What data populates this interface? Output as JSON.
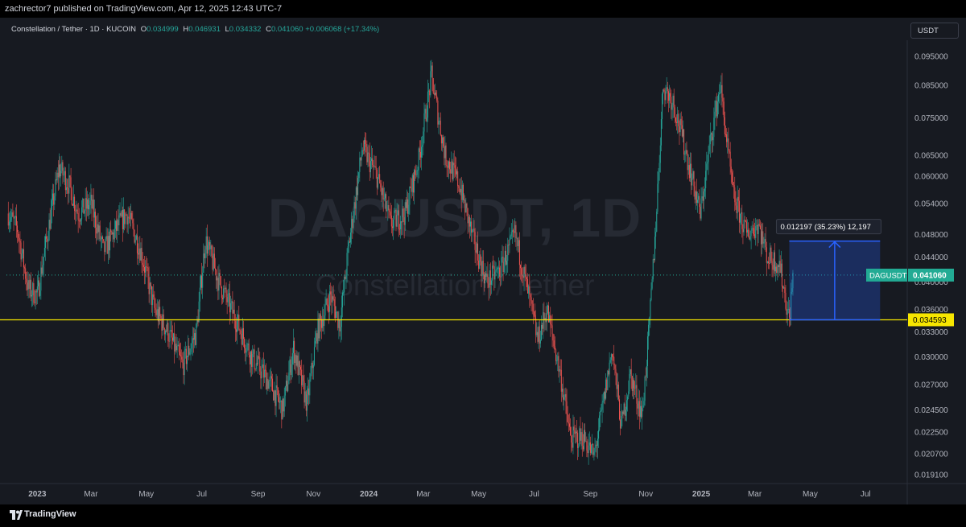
{
  "header": {
    "publisher_line": "zachrector7 published on TradingView.com, Apr 12, 2025 12:43 UTC-7"
  },
  "legend": {
    "symbol": "Constellation / Tether · 1D · KUCOIN",
    "o_label": "O",
    "o_value": "0.034999",
    "h_label": "H",
    "h_value": "0.046931",
    "l_label": "L",
    "l_value": "0.034332",
    "c_label": "C",
    "c_value": "0.041060",
    "change": "+0.006068 (+17.34%)"
  },
  "currency_button": "USDT",
  "watermark": {
    "main": "DAGUSDT, 1D",
    "sub": "Constellation / Tether"
  },
  "footer": {
    "brand": "TradingView"
  },
  "colors": {
    "up": "#26a69a",
    "down": "#ef5350",
    "background": "#171a21",
    "horizontal_line": "#f7e600",
    "measure": "#2962ff",
    "price_label": "#22ab94"
  },
  "chart_data": {
    "type": "candlestick",
    "scale": "log",
    "y_ticks": [
      0.0191,
      0.0207,
      0.0225,
      0.0245,
      0.027,
      0.03,
      0.033,
      0.036,
      0.04,
      0.044,
      0.048,
      0.054,
      0.06,
      0.065,
      0.075,
      0.085,
      0.095
    ],
    "y_tick_labels": [
      "0.019100",
      "0.020700",
      "0.022500",
      "0.024500",
      "0.027000",
      "0.030000",
      "0.033000",
      "0.036000",
      "0.040000",
      "0.044000",
      "0.048000",
      "0.054000",
      "0.060000",
      "0.065000",
      "0.075000",
      "0.085000",
      "0.095000"
    ],
    "x_labels": [
      "2023",
      "Mar",
      "May",
      "Jul",
      "Sep",
      "Nov",
      "2024",
      "Mar",
      "May",
      "Jul",
      "Sep",
      "Nov",
      "2025",
      "Mar",
      "May",
      "Jul"
    ],
    "x_label_dates": [
      "2023-01-01",
      "2023-03-01",
      "2023-05-01",
      "2023-07-01",
      "2023-09-01",
      "2023-11-01",
      "2024-01-01",
      "2024-03-01",
      "2024-05-01",
      "2024-07-01",
      "2024-09-01",
      "2024-11-01",
      "2025-01-01",
      "2025-03-01",
      "2025-05-01",
      "2025-07-01"
    ],
    "x_range": [
      "2022-11-28",
      "2025-08-15"
    ],
    "price_path": [
      [
        "2022-11-30",
        0.052
      ],
      [
        "2022-12-10",
        0.049
      ],
      [
        "2022-12-22",
        0.039
      ],
      [
        "2023-01-01",
        0.038
      ],
      [
        "2023-01-10",
        0.046
      ],
      [
        "2023-01-25",
        0.062
      ],
      [
        "2023-02-05",
        0.058
      ],
      [
        "2023-02-15",
        0.052
      ],
      [
        "2023-03-01",
        0.054
      ],
      [
        "2023-03-15",
        0.045
      ],
      [
        "2023-04-01",
        0.05
      ],
      [
        "2023-04-10",
        0.052
      ],
      [
        "2023-04-25",
        0.045
      ],
      [
        "2023-05-10",
        0.036
      ],
      [
        "2023-05-25",
        0.033
      ],
      [
        "2023-06-10",
        0.029
      ],
      [
        "2023-06-25",
        0.033
      ],
      [
        "2023-07-05",
        0.047
      ],
      [
        "2023-07-20",
        0.04
      ],
      [
        "2023-08-10",
        0.034
      ],
      [
        "2023-08-25",
        0.03
      ],
      [
        "2023-09-15",
        0.027
      ],
      [
        "2023-09-28",
        0.0245
      ],
      [
        "2023-10-10",
        0.031
      ],
      [
        "2023-10-25",
        0.025
      ],
      [
        "2023-11-05",
        0.033
      ],
      [
        "2023-11-20",
        0.038
      ],
      [
        "2023-11-30",
        0.034
      ],
      [
        "2023-12-10",
        0.046
      ],
      [
        "2023-12-25",
        0.067
      ],
      [
        "2024-01-10",
        0.06
      ],
      [
        "2024-01-25",
        0.05
      ],
      [
        "2024-02-10",
        0.052
      ],
      [
        "2024-02-25",
        0.064
      ],
      [
        "2024-03-10",
        0.088
      ],
      [
        "2024-03-25",
        0.065
      ],
      [
        "2024-04-10",
        0.058
      ],
      [
        "2024-04-25",
        0.047
      ],
      [
        "2024-05-10",
        0.04
      ],
      [
        "2024-05-25",
        0.042
      ],
      [
        "2024-06-10",
        0.048
      ],
      [
        "2024-06-25",
        0.038
      ],
      [
        "2024-07-05",
        0.032
      ],
      [
        "2024-07-15",
        0.036
      ],
      [
        "2024-07-30",
        0.028
      ],
      [
        "2024-08-10",
        0.022
      ],
      [
        "2024-08-25",
        0.022
      ],
      [
        "2024-09-05",
        0.0205
      ],
      [
        "2024-09-15",
        0.025
      ],
      [
        "2024-09-25",
        0.031
      ],
      [
        "2024-10-05",
        0.023
      ],
      [
        "2024-10-15",
        0.028
      ],
      [
        "2024-10-28",
        0.024
      ],
      [
        "2024-11-05",
        0.034
      ],
      [
        "2024-11-12",
        0.05
      ],
      [
        "2024-11-20",
        0.085
      ],
      [
        "2024-12-01",
        0.08
      ],
      [
        "2024-12-15",
        0.066
      ],
      [
        "2024-12-31",
        0.052
      ],
      [
        "2025-01-12",
        0.07
      ],
      [
        "2025-01-22",
        0.085
      ],
      [
        "2025-02-05",
        0.056
      ],
      [
        "2025-02-20",
        0.048
      ],
      [
        "2025-03-05",
        0.05
      ],
      [
        "2025-03-15",
        0.044
      ],
      [
        "2025-03-28",
        0.043
      ],
      [
        "2025-04-08",
        0.0345
      ],
      [
        "2025-04-12",
        0.041
      ]
    ],
    "last_price": 0.04106,
    "last_price_label": "0.041060",
    "symbol_label": "DAGUSDT",
    "horizontal_line": 0.034593,
    "horizontal_line_label": "0.034593",
    "measure": {
      "from_date": "2025-04-08",
      "to_date": "2025-07-17",
      "from_price": 0.034593,
      "to_price": 0.04679,
      "label": "0.012197 (35.23%) 12,197"
    }
  }
}
